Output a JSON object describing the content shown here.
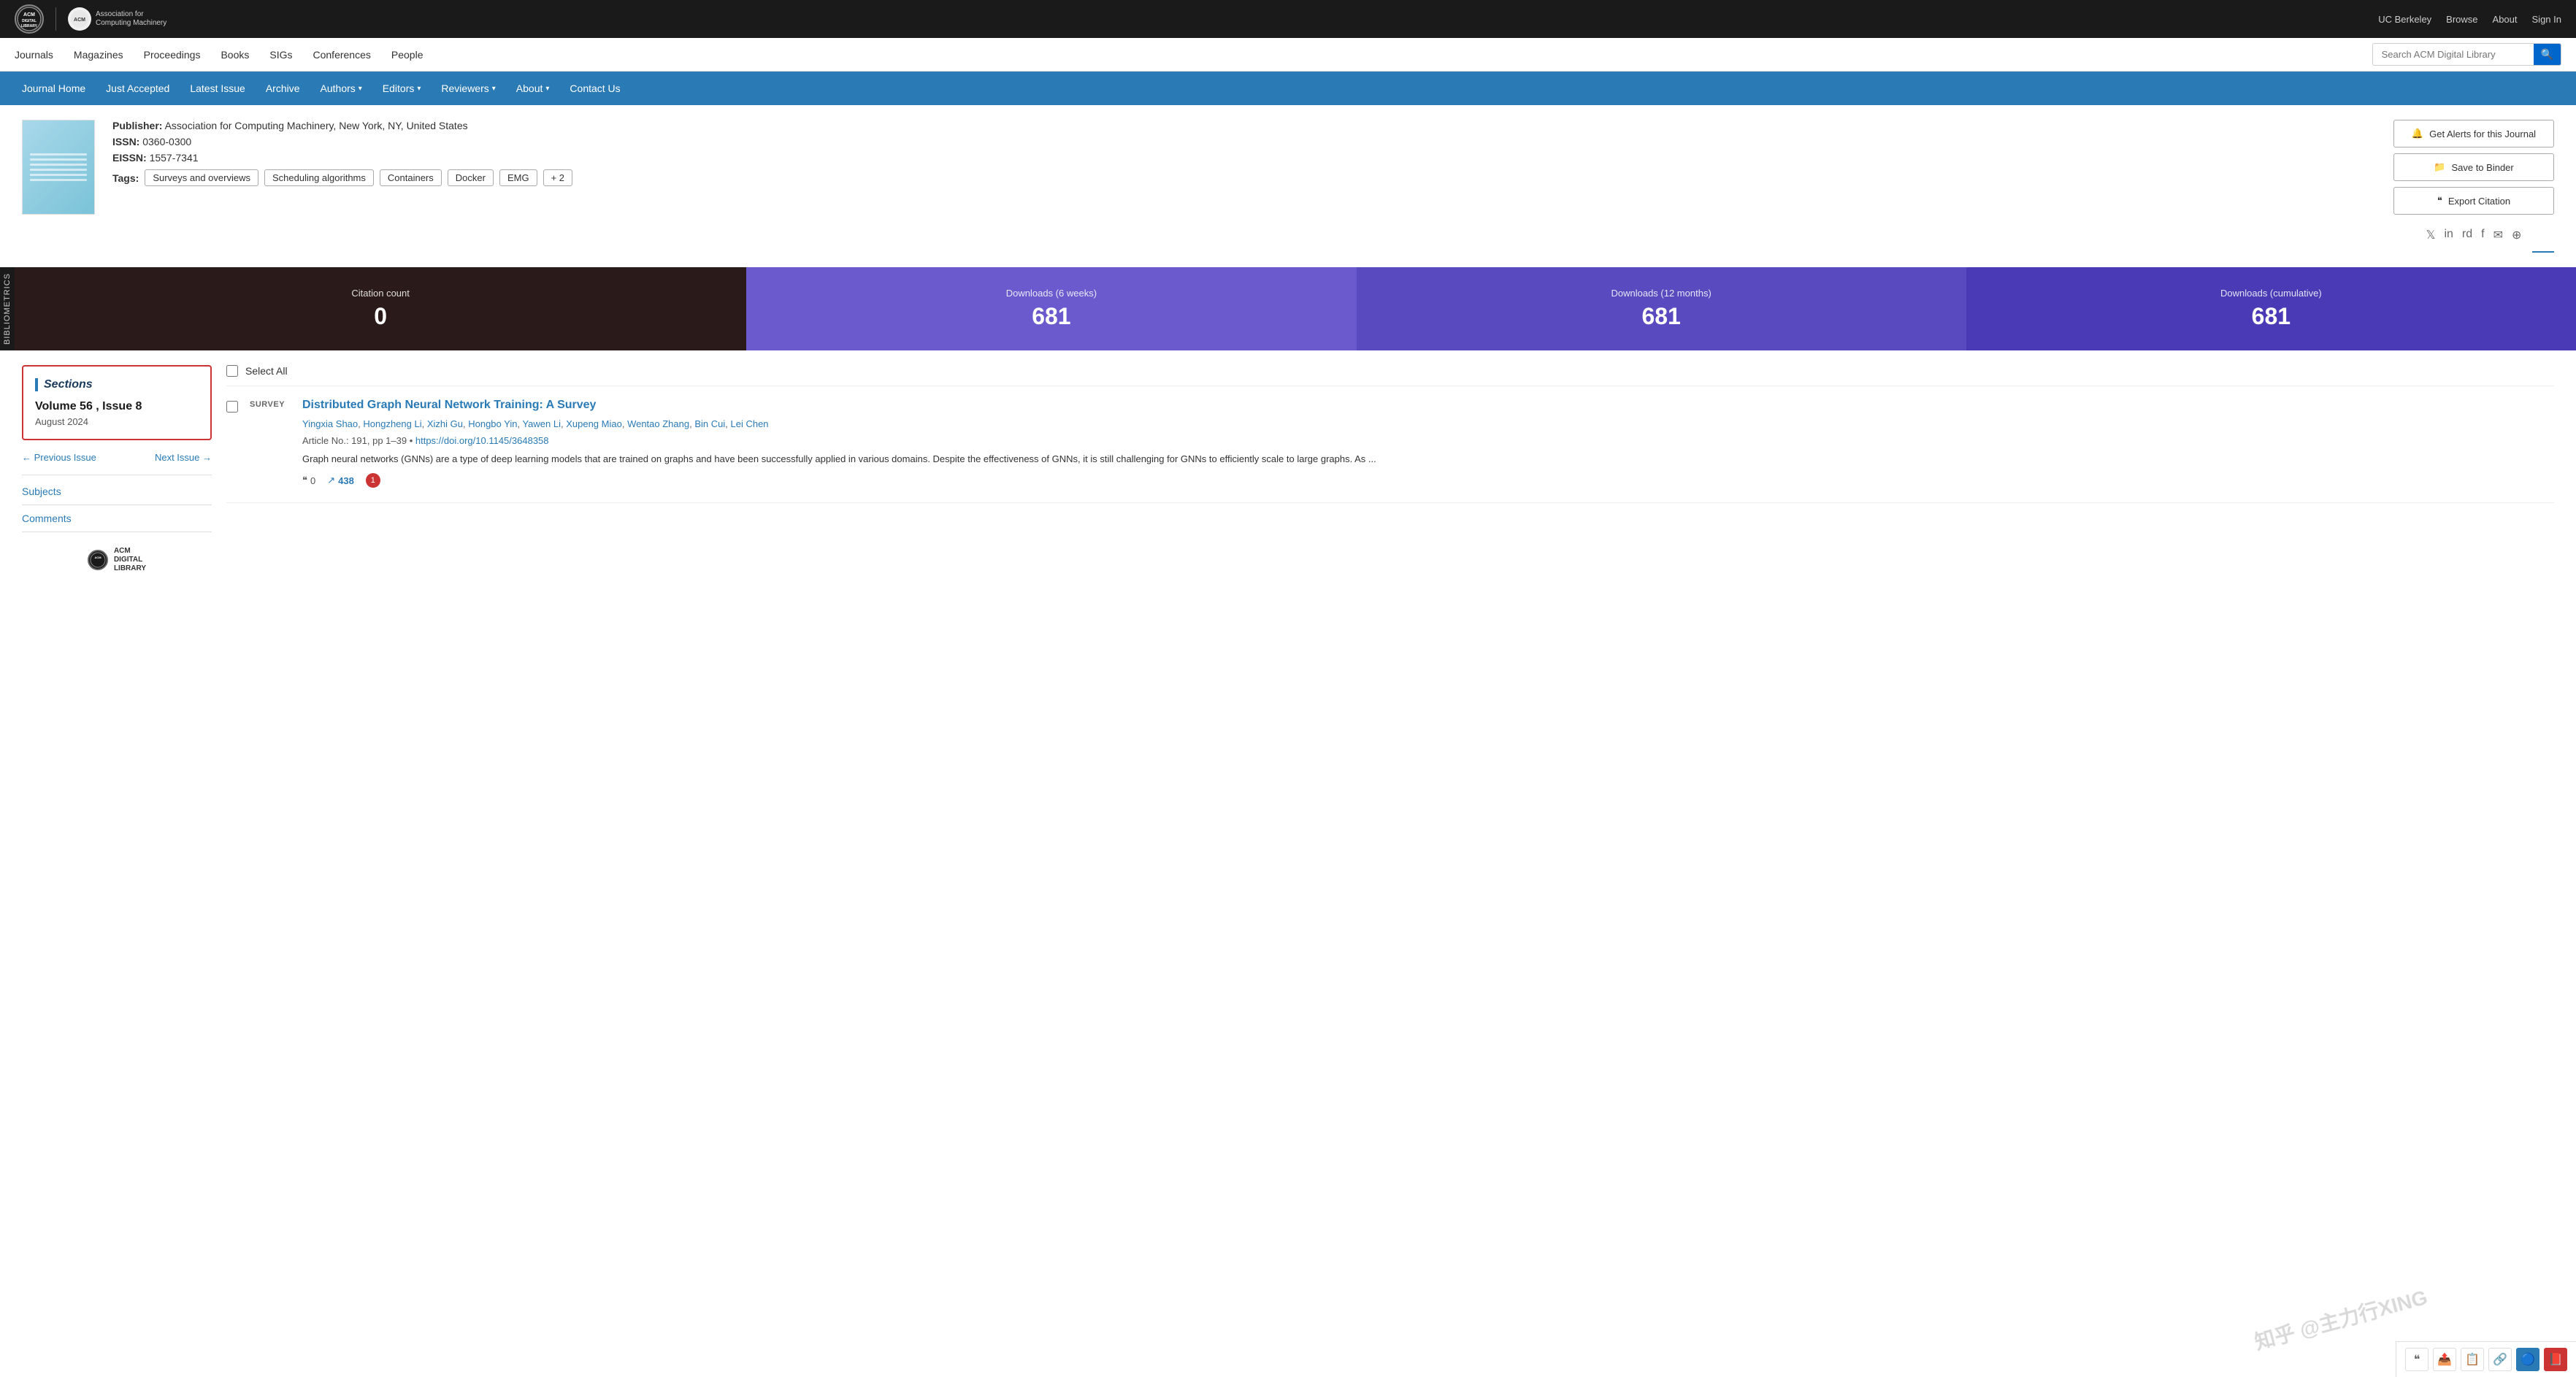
{
  "topNav": {
    "logoPrimary": "ACM\nDIGITAL\nLIBRARY",
    "logoSecondary": "Association for\nComputing Machinery",
    "links": [
      "UC Berkeley",
      "Browse",
      "About",
      "Sign In"
    ]
  },
  "secondaryNav": {
    "links": [
      "Journals",
      "Magazines",
      "Proceedings",
      "Books",
      "SIGs",
      "Conferences",
      "People"
    ],
    "searchPlaceholder": "Search ACM Digital Library"
  },
  "journalNav": {
    "links": [
      {
        "label": "Journal Home",
        "hasDropdown": false
      },
      {
        "label": "Just Accepted",
        "hasDropdown": false
      },
      {
        "label": "Latest Issue",
        "hasDropdown": false
      },
      {
        "label": "Archive",
        "hasDropdown": false
      },
      {
        "label": "Authors",
        "hasDropdown": true
      },
      {
        "label": "Editors",
        "hasDropdown": true
      },
      {
        "label": "Reviewers",
        "hasDropdown": true
      },
      {
        "label": "About",
        "hasDropdown": true
      },
      {
        "label": "Contact Us",
        "hasDropdown": false
      }
    ]
  },
  "journal": {
    "publisherLabel": "Publisher:",
    "publisherValue": "Association for Computing Machinery, New York, NY, United States",
    "issnLabel": "ISSN:",
    "issnValue": "0360-0300",
    "eissnLabel": "EISSN:",
    "eissnValue": "1557-7341",
    "tagsLabel": "Tags:",
    "tags": [
      "Surveys and overviews",
      "Scheduling algorithms",
      "Containers",
      "Docker",
      "EMG"
    ],
    "tagsMore": "+ 2"
  },
  "actions": {
    "alerts": "Get Alerts for this Journal",
    "binder": "Save to Binder",
    "citation": "Export Citation",
    "alertIcon": "🔔",
    "binderIcon": "📁",
    "citationIcon": "“”"
  },
  "socialLinks": [
    "𝕏",
    "in",
    "reddit",
    "f",
    "✉",
    "rss"
  ],
  "stats": {
    "citationLabel": "Citation count",
    "citationValue": "0",
    "downloads6Label": "Downloads (6 weeks)",
    "downloads6Value": "681",
    "downloads12Label": "Downloads (12 months)",
    "downloads12Value": "681",
    "downloadsCumLabel": "Downloads (cumulative)",
    "downloadsCumValue": "681"
  },
  "sections": {
    "title": "Sections",
    "issueTitle": "Volume 56 , Issue 8",
    "issueDate": "August 2024",
    "prevIssue": "← Previous Issue",
    "nextIssue": "Next Issue →",
    "sideLinks": [
      "Subjects",
      "Comments"
    ]
  },
  "selectAll": "Select All",
  "articles": [
    {
      "type": "SURVEY",
      "title": "Distributed Graph Neural Network Training: A Survey",
      "authors": [
        "Yingxia Shao",
        "Hongzheng Li",
        "Xizhi Gu",
        "Hongbo Yin",
        "Yawen Li",
        "Xupeng Miao",
        "Wentao Zhang",
        "Bin Cui",
        "Lei Chen"
      ],
      "articleNo": "Article No.: 191, pp 1–39",
      "doi": "https://doi.org/10.1145/3648358",
      "abstract": "Graph neural networks (GNNs) are a type of deep learning models that are trained on graphs and have been successfully applied in various domains. Despite the effectiveness of GNNs, it is still challenging for GNNs to efficiently scale to large graphs. As ...",
      "citationCount": "0",
      "downloadCount": "438",
      "attachmentCount": "1"
    }
  ],
  "watermark": "知乎 @主力行XING",
  "bottomToolbar": {
    "buttons": [
      "\"\"",
      "📤",
      "📋",
      "🔗",
      "blue",
      "red"
    ]
  }
}
